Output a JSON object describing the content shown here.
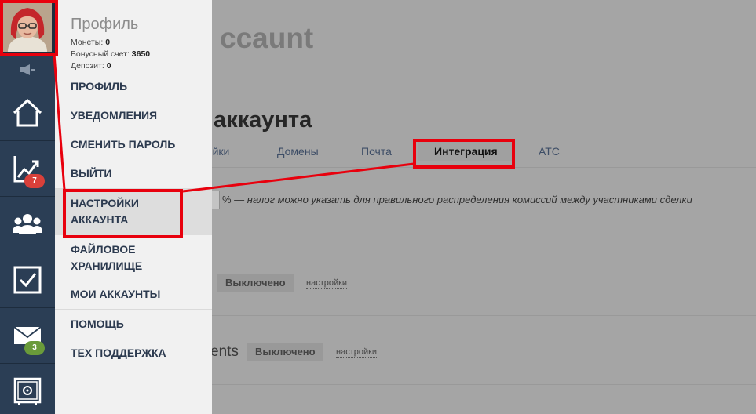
{
  "background": {
    "app_title": "ccaunt",
    "heading": "аккаунта",
    "tabs": [
      {
        "label": "ройки",
        "active": false
      },
      {
        "label": "Домены",
        "active": false
      },
      {
        "label": "Почта",
        "active": false
      },
      {
        "label": "Интеграция",
        "active": true
      },
      {
        "label": "АТС",
        "active": false
      }
    ],
    "tax_hint_prefix": "% — ",
    "tax_hint": "налог можно указать для правильного распределения комиссий между участниками сделки",
    "setting1": {
      "status": "Выключено",
      "link": "настройки"
    },
    "setting2": {
      "name": "ents",
      "status": "Выключено",
      "link": "настройки"
    }
  },
  "sidebar": {
    "items": [
      {
        "icon": "home-icon"
      },
      {
        "icon": "stats-icon",
        "badge": "7",
        "badge_color": "#d9403a"
      },
      {
        "icon": "contacts-icon"
      },
      {
        "icon": "tasks-icon"
      },
      {
        "icon": "mail-icon",
        "badge": "3",
        "badge_color": "#6a9b3a"
      },
      {
        "icon": "safe-icon"
      }
    ]
  },
  "profile": {
    "title": "Профиль",
    "coins_label": "Монеты:",
    "coins_value": "0",
    "bonus_label": "Бонусный счет:",
    "bonus_value": "3650",
    "deposit_label": "Депозит:",
    "deposit_value": "0",
    "menu": [
      {
        "label": "ПРОФИЛЬ"
      },
      {
        "label": "УВЕДОМЛЕНИЯ"
      },
      {
        "label": "СМЕНИТЬ ПАРОЛЬ"
      },
      {
        "label": "ВЫЙТИ"
      },
      {
        "label": "НАСТРОЙКИ АККАУНТА",
        "line1": "НАСТРОЙКИ",
        "line2": "АККАУНТА",
        "active": true
      },
      {
        "label": "ФАЙЛОВОЕ ХРАНИЛИЩЕ",
        "line1": "ФАЙЛОВОЕ",
        "line2": "ХРАНИЛИЩЕ"
      },
      {
        "label": "МОИ АККАУНТЫ"
      },
      {
        "label": "ПОМОЩЬ"
      },
      {
        "label": "ТЕХ ПОДДЕРЖКА"
      }
    ]
  },
  "colors": {
    "annotation": "#e8000d",
    "sidebar": "#2b3e55",
    "panel": "#f1f1f1"
  }
}
